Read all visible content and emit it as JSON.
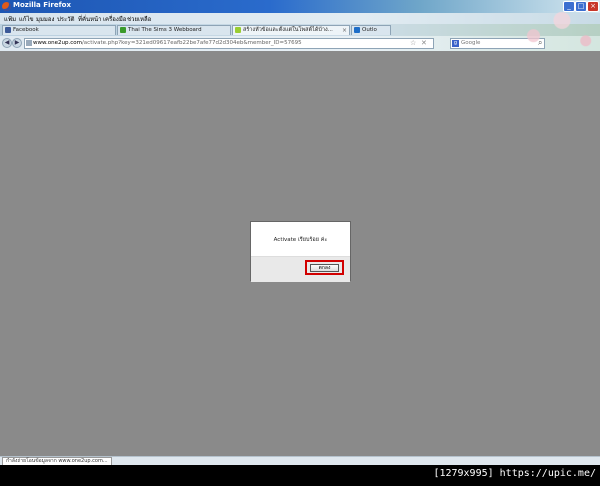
{
  "window": {
    "title": "Mozilla Firefox"
  },
  "menu": [
    {
      "id": "file",
      "label": "แฟ้ม"
    },
    {
      "id": "edit",
      "label": "แก้ไข"
    },
    {
      "id": "view",
      "label": "มุมมอง"
    },
    {
      "id": "history",
      "label": "ประวัติ"
    },
    {
      "id": "bookmarks",
      "label": "ที่คั่นหน้า"
    },
    {
      "id": "tools",
      "label": "เครื่องมือ"
    },
    {
      "id": "help",
      "label": "ช่วยเหลือ"
    }
  ],
  "tabs": [
    {
      "label": "Facebook",
      "color": "#3b5998"
    },
    {
      "label": "Thai The Sims 3 Webboard",
      "color": "#3a9a2a"
    },
    {
      "label": "สร้างหัวข้อและตั้งแต่ในโพสต์ได้บ้าง...",
      "color": "#9acd32"
    },
    {
      "label": "Outlo",
      "color": "#1e6ec8"
    }
  ],
  "address": {
    "domain": "www.one2up.com",
    "path": "/activate.php?key=321ed09617eafb22be7afe77d2d304eb&member_ID=57695"
  },
  "search": {
    "placeholder": "Google"
  },
  "dialog": {
    "message": "Activate เรียบร้อย ค่ะ",
    "ok_label": "ตกลง"
  },
  "status": {
    "text": "กำลังถ่ายโอนข้อมูลจาก www.one2up.com..."
  },
  "watermark": "[1279x995] https://upic.me/"
}
